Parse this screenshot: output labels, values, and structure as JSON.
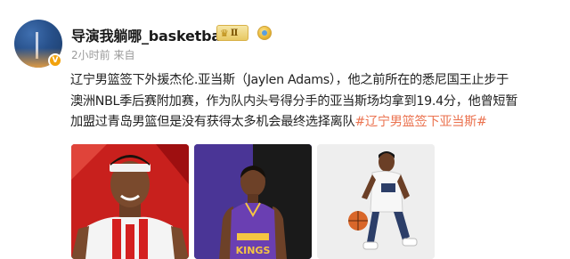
{
  "post": {
    "username": "导演我躺哪_basketball",
    "level": "Ⅱ",
    "time": "2小时前",
    "via": "来自",
    "text_lines": [
      "辽宁男篮签下外援杰伦.亚当斯（Jaylen Adams），他之前所在的悉尼国王止步于",
      "澳洲NBL季后赛附加赛，作为队内头号得分手的亚当斯场均拿到19.4分，他曾短暂",
      "加盟过青岛男篮但是没有获得太多机会最终选择离队"
    ],
    "hashtag": "#辽宁男篮签下亚当斯#"
  },
  "images": [
    {
      "name": "photo-player-red-jersey"
    },
    {
      "name": "photo-player-kings-jersey",
      "jersey_text": "KINGS"
    },
    {
      "name": "photo-player-dribbling"
    }
  ],
  "colors": {
    "hashtag": "#eb7350",
    "meta": "#9a9a9a",
    "verified": "#f2a20d"
  }
}
